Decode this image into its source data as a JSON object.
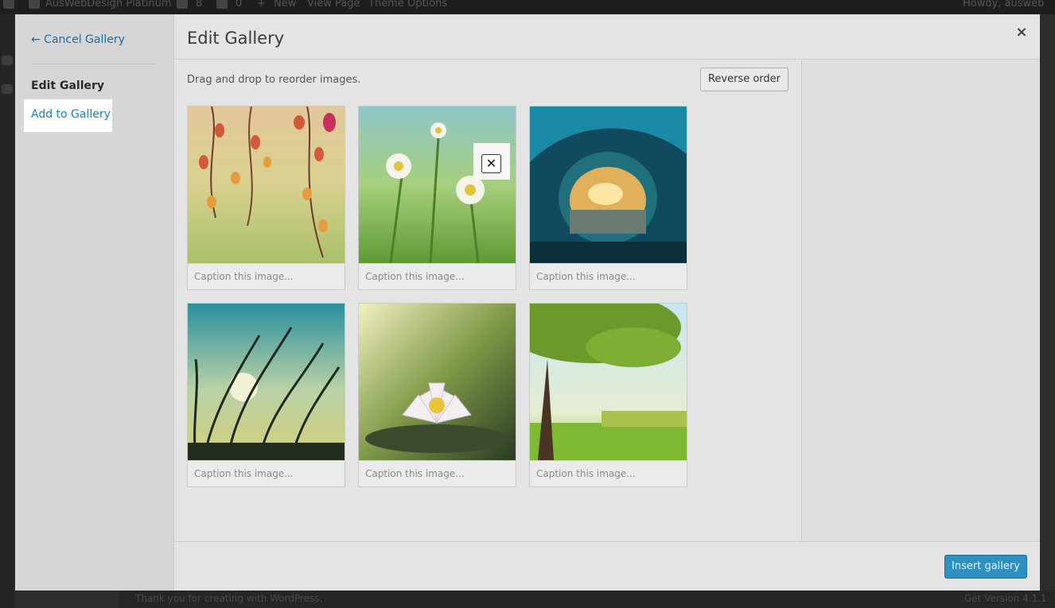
{
  "admin_bar": {
    "site_name": "AusWebDesign Platinum",
    "updates_count": "8",
    "comments_count": "0",
    "new_label": "New",
    "view_page": "View Page",
    "theme_options": "Theme Options",
    "howdy": "Howdy, ausweb"
  },
  "footer_bar": {
    "left_text": "Thank you for creating with WordPress.",
    "right_text": "Get Version 4.1.1"
  },
  "menu": {
    "cancel_label": "← Cancel Gallery",
    "edit_gallery_label": "Edit Gallery",
    "add_to_gallery_label": "Add to Gallery"
  },
  "title": "Edit Gallery",
  "close_glyph": "×",
  "toolbar": {
    "instructions": "Drag and drop to reorder images.",
    "reverse_label": "Reverse order"
  },
  "gallery": {
    "images": [
      {
        "alt": "autumn-leaves",
        "caption_placeholder": "Caption this image..."
      },
      {
        "alt": "daisies",
        "caption_placeholder": "Caption this image..."
      },
      {
        "alt": "wave-sunset",
        "caption_placeholder": "Caption this image..."
      },
      {
        "alt": "reeds-sky",
        "caption_placeholder": "Caption this image..."
      },
      {
        "alt": "water-lily",
        "caption_placeholder": "Caption this image..."
      },
      {
        "alt": "tree-meadow",
        "caption_placeholder": "Caption this image..."
      }
    ],
    "remove_glyph": "✕"
  },
  "footer": {
    "insert_label": "Insert gallery"
  },
  "colors": {
    "accent": "#2e8fc1",
    "link": "#1e6b9e"
  }
}
